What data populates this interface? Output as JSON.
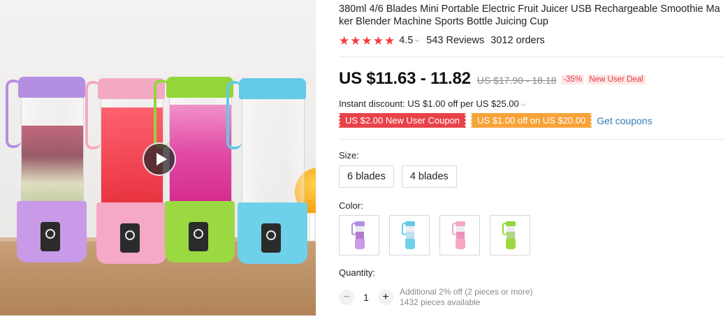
{
  "product": {
    "title": "380ml 4/6 Blades Mini Portable Electric Fruit Juicer USB Rechargeable Smoothie Maker Blender Machine Sports Bottle Juicing Cup",
    "rating": "4.5",
    "stars": 5,
    "reviews": "543 Reviews",
    "orders": "3012 orders"
  },
  "price": {
    "current": "US $11.63 - 11.82",
    "original": "US $17.90 - 18.18",
    "discount_badge": "-35%",
    "deal_badge": "New User Deal"
  },
  "discount": {
    "text": "Instant discount: US $1.00 off per US $25.00"
  },
  "coupons": {
    "items": [
      "US $2.00 New User Coupon",
      "US $1.00 off on US $20.00"
    ],
    "link": "Get coupons",
    "colors": [
      "#e9434a",
      "#f7a33a"
    ]
  },
  "size": {
    "label": "Size:",
    "options": [
      "6 blades",
      "4 blades"
    ]
  },
  "color": {
    "label": "Color:",
    "options": [
      {
        "name": "purple",
        "cap": "#b48ee0",
        "base": "#c89ae8",
        "fill": "#9b4db8"
      },
      {
        "name": "blue",
        "cap": "#63c9e6",
        "base": "#6fd0ea",
        "fill": "#8fd8ef"
      },
      {
        "name": "pink",
        "cap": "#f4a9c2",
        "base": "#f6a8c7",
        "fill": "#e95b8f"
      },
      {
        "name": "green",
        "cap": "#92d63a",
        "base": "#9ad942",
        "fill": "#7cc52c"
      }
    ]
  },
  "quantity": {
    "label": "Quantity:",
    "minus": "−",
    "plus": "+",
    "value": "1",
    "note_line1": "Additional 2% off (2 pieces or more)",
    "note_line2": "1432 pieces available"
  },
  "media": {
    "play_icon": "play-icon"
  }
}
